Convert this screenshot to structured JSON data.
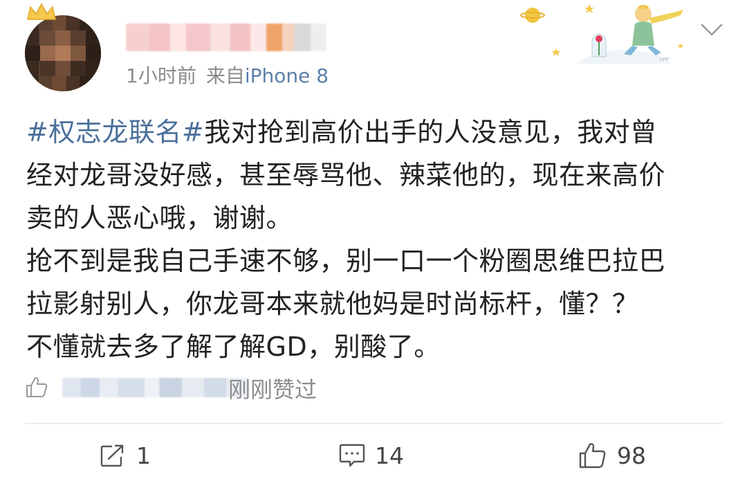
{
  "post": {
    "time": "1小时前",
    "source_prefix": "来自",
    "device": "iPhone 8",
    "hashtag": "#权志龙联名#",
    "lines": [
      "我对抢到高价出手的人没意见，我对曾",
      "经对龙哥没好感，甚至辱骂他、辣菜他的，现在来高价",
      "卖的人恶心哦，谢谢。",
      "抢不到是我自己手速不够，别一口一个粉圈思维巴拉巴",
      "拉影射别人，你龙哥本来就他妈是时尚标杆，懂？？",
      "不懂就去多了解了解GD，别酸了。"
    ]
  },
  "likes": {
    "liked_text": "刚刚赞过"
  },
  "actions": {
    "repost_count": "1",
    "comment_count": "14",
    "like_count": "98"
  },
  "colors": {
    "hashtag": "#4a6f9a",
    "device": "#5b7fa9",
    "meta": "#8c8c8c",
    "text": "#222222"
  },
  "icons": {
    "menu": "chevron-down-icon",
    "like_small": "thumbs-up-icon",
    "repost": "repost-icon",
    "comment": "comment-icon",
    "like": "thumbs-up-icon"
  }
}
